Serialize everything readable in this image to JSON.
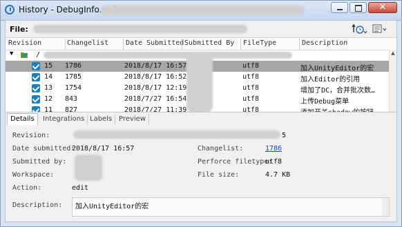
{
  "window": {
    "title": "History - DebugInfo.cs (",
    "title_suffix": ")",
    "close_label": "✕"
  },
  "filebar": {
    "label": "File:"
  },
  "grid": {
    "columns": [
      "Revision",
      "Changelist",
      "Date Submitted",
      "Submitted By",
      "FileType",
      "Description"
    ],
    "root_label": "/",
    "rows": [
      {
        "revision": "15",
        "changelist": "1786",
        "date": "2018/8/17 16:57",
        "filetype": "utf8",
        "description": "加入UnityEditor的宏",
        "selected": true
      },
      {
        "revision": "14",
        "changelist": "1785",
        "date": "2018/8/17 16:52",
        "filetype": "utf8",
        "description": "加入Editor的引用",
        "selected": false
      },
      {
        "revision": "13",
        "changelist": "1754",
        "date": "2018/8/17 12:19",
        "filetype": "utf8",
        "description": "增加了DC，合并批次数…",
        "selected": false
      },
      {
        "revision": "12",
        "changelist": "843",
        "date": "2018/7/27 16:54",
        "filetype": "utf8",
        "description": "上传Debug菜单",
        "selected": false
      },
      {
        "revision": "11",
        "changelist": "827",
        "date": "2018/7/27 11:39",
        "filetype": "utf8",
        "description": "添加开关shadow的按钮…",
        "selected": false
      }
    ]
  },
  "tabs": [
    "Details",
    "Integrations",
    "Labels",
    "Preview"
  ],
  "details": {
    "revision_label": "Revision:",
    "revision_value": "5",
    "date_label": "Date submitted:",
    "date_value": "2018/8/17 16:57",
    "changelist_label": "Changelist:",
    "changelist_value": "1786",
    "submitted_by_label": "Submitted by:",
    "filetype_label": "Perforce filetype:",
    "filetype_value": "utf8",
    "workspace_label": "Workspace:",
    "filesize_label": "File size:",
    "filesize_value": "4.7 KB",
    "action_label": "Action:",
    "action_value": "edit",
    "description_label": "Description:",
    "description_value": "加入UnityEditor的宏"
  },
  "colors": {
    "selection": "#a6a6a6",
    "link": "#1a47c8",
    "checkbox": "#1e7fbf"
  }
}
